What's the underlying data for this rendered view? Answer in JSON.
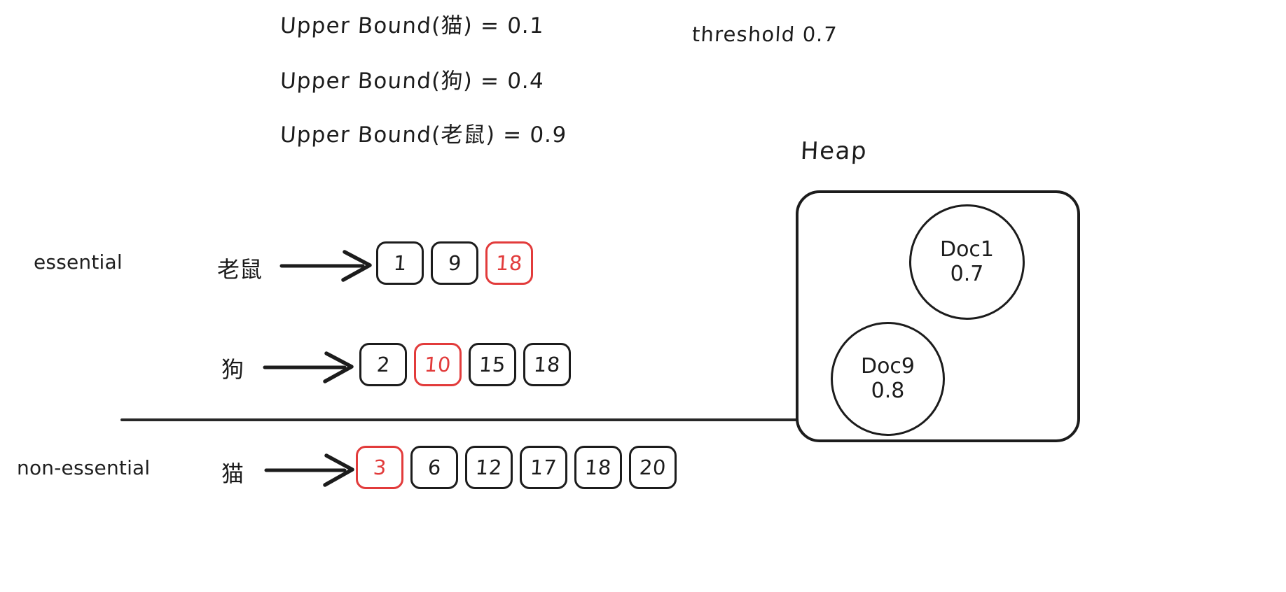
{
  "upper_bounds": [
    {
      "text": "Upper Bound(猫) = 0.1",
      "term": "猫",
      "value": 0.1
    },
    {
      "text": "Upper Bound(狗) = 0.4",
      "term": "狗",
      "value": 0.4
    },
    {
      "text": "Upper Bound(老鼠) = 0.9",
      "term": "老鼠",
      "value": 0.9
    }
  ],
  "threshold": {
    "label": "threshold 0.7",
    "value": 0.7
  },
  "groups": {
    "essential_label": "essential",
    "non_essential_label": "non-essential"
  },
  "postings": [
    {
      "term": "老鼠",
      "group": "essential",
      "arrow": "right-arrow-icon",
      "cells": [
        {
          "value": "1",
          "highlighted": false
        },
        {
          "value": "9",
          "highlighted": false
        },
        {
          "value": "18",
          "highlighted": true
        }
      ]
    },
    {
      "term": "狗",
      "group": "essential",
      "arrow": "right-arrow-icon",
      "cells": [
        {
          "value": "2",
          "highlighted": false
        },
        {
          "value": "10",
          "highlighted": true
        },
        {
          "value": "15",
          "highlighted": false
        },
        {
          "value": "18",
          "highlighted": false
        }
      ]
    },
    {
      "term": "猫",
      "group": "non-essential",
      "arrow": "right-arrow-icon",
      "cells": [
        {
          "value": "3",
          "highlighted": true
        },
        {
          "value": "6",
          "highlighted": false
        },
        {
          "value": "12",
          "highlighted": false
        },
        {
          "value": "17",
          "highlighted": false
        },
        {
          "value": "18",
          "highlighted": false
        },
        {
          "value": "20",
          "highlighted": false
        }
      ]
    }
  ],
  "heap": {
    "title": "Heap",
    "nodes": [
      {
        "name": "Doc1",
        "score": "0.7"
      },
      {
        "name": "Doc9",
        "score": "0.8"
      }
    ]
  },
  "colors": {
    "ink": "#1c1c1c",
    "highlight_red": "#e23b3b",
    "background": "#ffffff"
  }
}
